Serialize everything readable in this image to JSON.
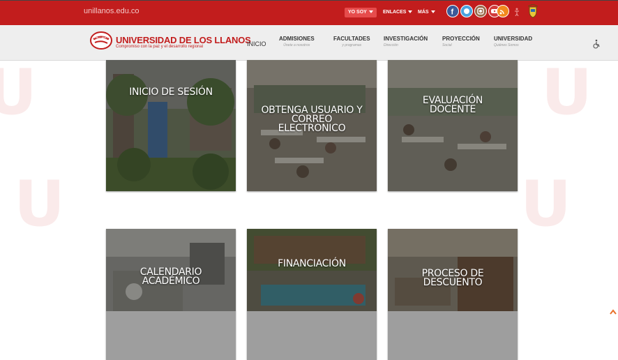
{
  "topbar": {
    "domain": "unillanos.edu.co",
    "yo_soy": "YO SOY",
    "enlaces": "ENLACES",
    "mas": "MÁS",
    "colors": {
      "bar": "#c21d1d",
      "pill": "#e64c4c"
    },
    "social_icons": [
      "facebook-icon",
      "twitter-icon",
      "instagram-icon",
      "youtube-icon",
      "rss-icon",
      "accessibility-icon",
      "coat-of-arms-icon"
    ]
  },
  "header": {
    "logo_title": "UNIVERSIDAD DE LOS LLANOS",
    "logo_subtitle": "Compromiso con la paz y el desarrollo regional",
    "logo_badge": "UNILLANOS",
    "nav": [
      {
        "label": "INICIO",
        "sub": ""
      },
      {
        "label": "ADMISIONES",
        "sub": "Únete a nosotros"
      },
      {
        "label": "FACULTADES",
        "sub": "y programas"
      },
      {
        "label": "INVESTIGACIÓN",
        "sub": "Dirección"
      },
      {
        "label": "PROYECCIÓN",
        "sub": "Social"
      },
      {
        "label": "UNIVERSIDAD",
        "sub": "Quiénes Somos"
      }
    ],
    "accessibility_icon": "wheelchair-icon"
  },
  "tiles": [
    {
      "label": "INICIO DE SESIÓN"
    },
    {
      "label": "OBTENGA USUARIO Y CORREO ELECTRONICO"
    },
    {
      "label": "EVALUACIÓN DOCENTE"
    },
    {
      "label": "CALENDARIO ACADÉMICO"
    },
    {
      "label": "FINANCIACIÓN"
    },
    {
      "label": "PROCESO DE DESCUENTO"
    }
  ]
}
